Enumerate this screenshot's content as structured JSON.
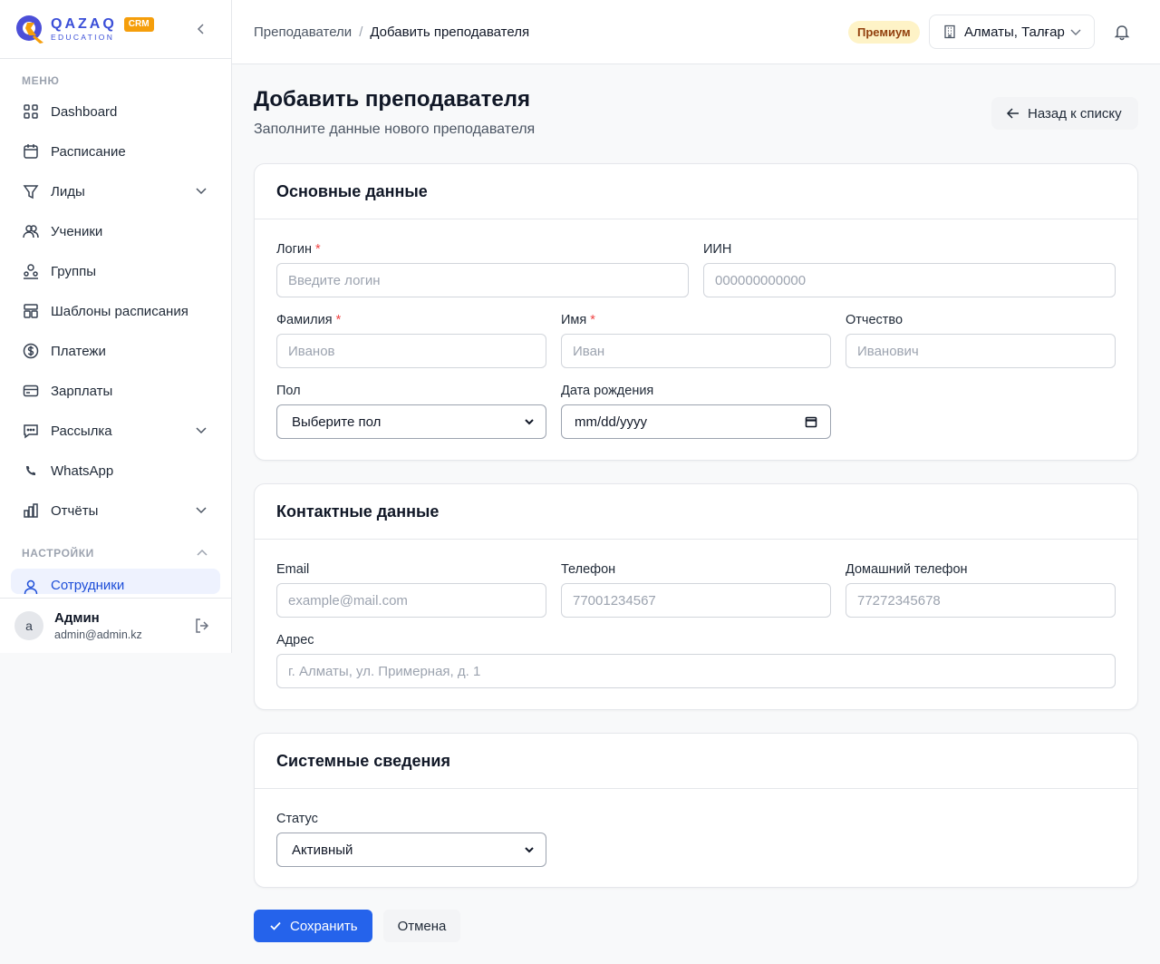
{
  "logo": {
    "brand": "QAZAQ",
    "tagline": "EDUCATION",
    "badge": "CRM"
  },
  "sidebar": {
    "menu_label": "МЕНЮ",
    "items": [
      {
        "label": "Dashboard",
        "icon": "dashboard-icon"
      },
      {
        "label": "Расписание",
        "icon": "calendar-icon"
      },
      {
        "label": "Лиды",
        "icon": "funnel-icon",
        "has_submenu": true
      },
      {
        "label": "Ученики",
        "icon": "users-icon"
      },
      {
        "label": "Группы",
        "icon": "group-icon"
      },
      {
        "label": "Шаблоны расписания",
        "icon": "template-icon"
      },
      {
        "label": "Платежи",
        "icon": "dollar-icon"
      },
      {
        "label": "Зарплаты",
        "icon": "card-icon"
      },
      {
        "label": "Рассылка",
        "icon": "message-icon",
        "has_submenu": true
      },
      {
        "label": "WhatsApp",
        "icon": "phone-icon"
      },
      {
        "label": "Отчёты",
        "icon": "chart-icon",
        "has_submenu": true
      }
    ],
    "settings_label": "НАСТРОЙКИ",
    "settings_items": [
      {
        "label": "Сотрудники",
        "icon": "user-icon",
        "active": true
      }
    ]
  },
  "user": {
    "avatar_letter": "a",
    "name": "Админ",
    "email": "admin@admin.kz"
  },
  "header": {
    "breadcrumb_parent": "Преподаватели",
    "breadcrumb_sep": "/",
    "breadcrumb_current": "Добавить преподавателя",
    "plan_badge": "Премиум",
    "branch": "Алматы, Талғар"
  },
  "page": {
    "title": "Добавить преподавателя",
    "subtitle": "Заполните данные нового преподавателя",
    "back_label": "Назад к списку"
  },
  "basic": {
    "title": "Основные данные",
    "login_label": "Логин",
    "login_placeholder": "Введите логин",
    "iin_label": "ИИН",
    "iin_placeholder": "000000000000",
    "lastname_label": "Фамилия",
    "lastname_placeholder": "Иванов",
    "firstname_label": "Имя",
    "firstname_placeholder": "Иван",
    "middlename_label": "Отчество",
    "middlename_placeholder": "Иванович",
    "gender_label": "Пол",
    "gender_value": "Выберите пол",
    "birth_label": "Дата рождения",
    "birth_value": "mm/dd/yyyy",
    "required_mark": "*"
  },
  "contact": {
    "title": "Контактные данные",
    "email_label": "Email",
    "email_placeholder": "example@mail.com",
    "phone_label": "Телефон",
    "phone_placeholder": "77001234567",
    "home_phone_label": "Домашний телефон",
    "home_phone_placeholder": "77272345678",
    "address_label": "Адрес",
    "address_placeholder": "г. Алматы, ул. Примерная, д. 1"
  },
  "system": {
    "title": "Системные сведения",
    "status_label": "Статус",
    "status_value": "Активный"
  },
  "actions": {
    "save": "Сохранить",
    "cancel": "Отмена"
  },
  "colors": {
    "primary": "#2563eb",
    "brand": "#3b4fd8",
    "accent": "#f59e0b",
    "premium_bg": "#fef3c7"
  }
}
